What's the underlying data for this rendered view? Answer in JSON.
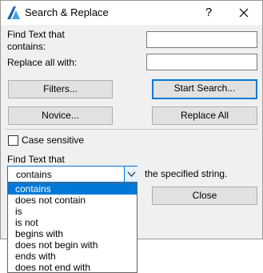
{
  "window": {
    "title": "Search & Replace",
    "help_glyph": "?"
  },
  "find": {
    "label_line1": "Find Text that",
    "label_line2": "contains:",
    "value": ""
  },
  "replace": {
    "label": "Replace all with:",
    "value": ""
  },
  "buttons": {
    "filters": "Filters...",
    "start_search": "Start Search...",
    "novice": "Novice...",
    "replace_all": "Replace All",
    "close": "Close"
  },
  "case_sensitive": {
    "label": "Case sensitive",
    "checked": false
  },
  "find_mode": {
    "label": "Find Text that",
    "selected": "contains",
    "suffix": "the specified string.",
    "options": [
      "contains",
      "does not contain",
      "is",
      "is not",
      "begins with",
      "does not begin with",
      "ends with",
      "does not end with"
    ]
  },
  "colors": {
    "accent": "#0078d7",
    "dialog_bg": "#f0f0f0"
  }
}
